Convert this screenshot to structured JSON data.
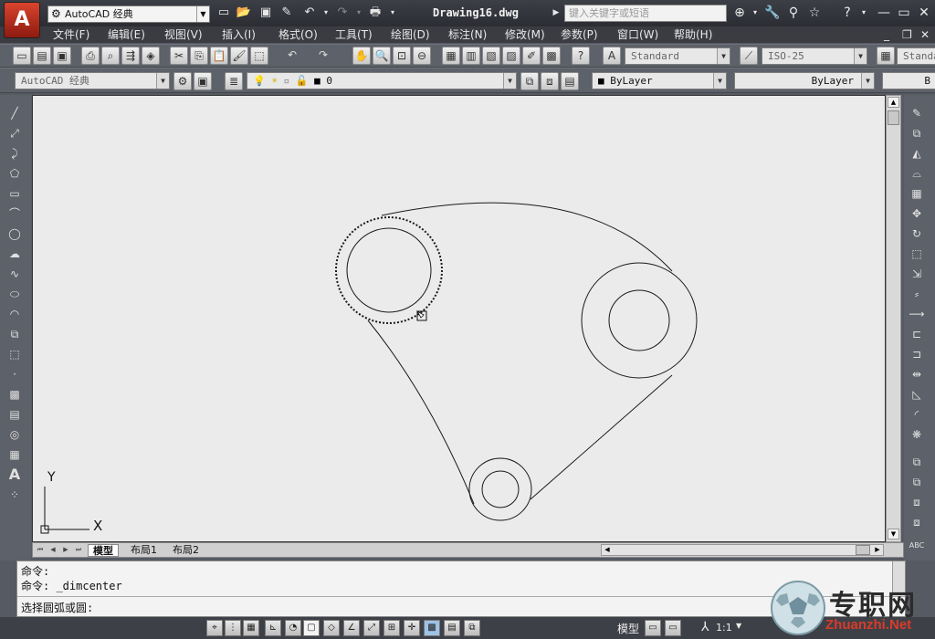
{
  "app": {
    "button_label": "A",
    "workspace": "AutoCAD 经典",
    "workspace_tb": "AutoCAD 经典"
  },
  "document": {
    "title": "Drawing16.dwg"
  },
  "search": {
    "placeholder": "键入关键字或短语"
  },
  "menu": [
    "文件(F)",
    "编辑(E)",
    "视图(V)",
    "插入(I)",
    "格式(O)",
    "工具(T)",
    "绘图(D)",
    "标注(N)",
    "修改(M)",
    "参数(P)",
    "窗口(W)",
    "帮助(H)"
  ],
  "styles": {
    "text_style": "Standard",
    "dim_style": "ISO-25",
    "table_style": "Standa"
  },
  "layer": {
    "name": "0"
  },
  "properties": {
    "color": "ByLayer",
    "linetype": "ByLayer",
    "lineweight": "B"
  },
  "ucs": {
    "x_label": "X",
    "y_label": "Y"
  },
  "layout_tabs": [
    "模型",
    "布局1",
    "布局2"
  ],
  "command": {
    "history": [
      "命令:",
      "命令: _dimcenter"
    ],
    "prompt": "选择圆弧或圆:"
  },
  "status": {
    "model": "模型",
    "scale": "1:1"
  },
  "watermark": {
    "brand": "专职网",
    "url": "Zhuanzhi.Net"
  },
  "colors": {
    "titlebar": "#2b2d33",
    "canvas": "#ebebeb",
    "accent_red": "#c8341f"
  }
}
